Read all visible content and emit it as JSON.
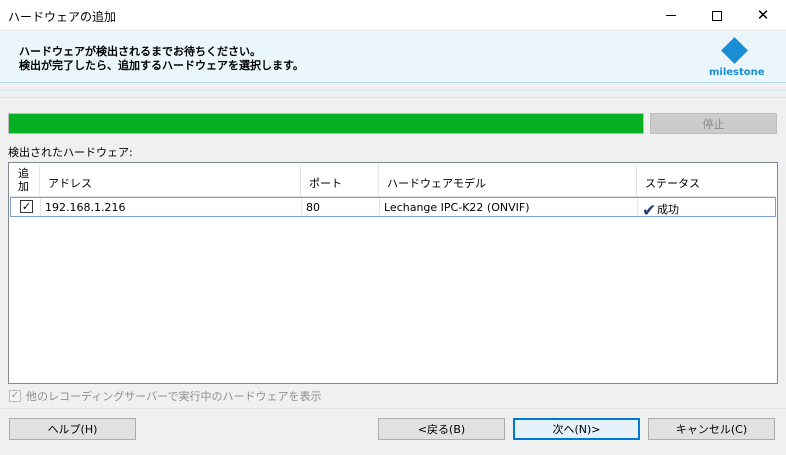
{
  "window": {
    "title": "ハードウェアの追加"
  },
  "header": {
    "line1": "ハードウェアが検出されるまでお待ちください。",
    "line2": "検出が完了したら、追加するハードウェアを選択します。",
    "logo_text": "milestone",
    "logo_color": "#1a8fd6"
  },
  "progress": {
    "percent": 100,
    "color": "#06b025",
    "stop_label": "停止"
  },
  "list": {
    "label": "検出されたハードウェア:",
    "columns": [
      "追加",
      "アドレス",
      "ポート",
      "ハードウェアモデル",
      "ステータス"
    ],
    "rows": [
      {
        "checked": true,
        "address": "192.168.1.216",
        "port": "80",
        "model": "Lechange IPC-K22 (ONVIF)",
        "status": "成功",
        "status_icon": "checkmark-icon"
      }
    ]
  },
  "options": {
    "show_other_label": "他のレコーディングサーバーで実行中のハードウェアを表示",
    "show_other_checked": true
  },
  "buttons": {
    "help": "ヘルプ(H)",
    "back": "<戻る(B)",
    "next": "次へ(N)>",
    "cancel": "キャンセル(C)"
  }
}
